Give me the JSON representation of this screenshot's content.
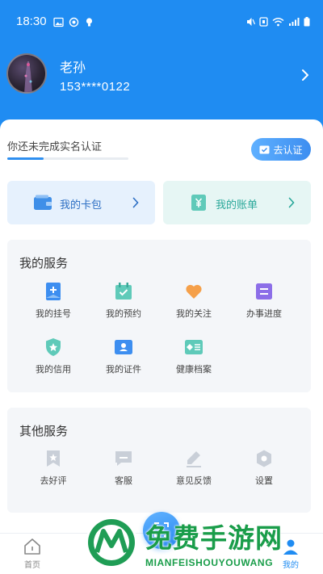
{
  "status_bar": {
    "time": "18:30"
  },
  "profile": {
    "name": "老孙",
    "phone": "153****0122"
  },
  "verify": {
    "text": "你还未完成实名认证",
    "button": "去认证",
    "progress": 0.3
  },
  "quick": {
    "wallet_label": "我的卡包",
    "bill_label": "我的账单"
  },
  "my_services": {
    "title": "我的服务",
    "items": [
      {
        "label": "我的挂号",
        "icon": "register-icon"
      },
      {
        "label": "我的预约",
        "icon": "appointment-icon"
      },
      {
        "label": "我的关注",
        "icon": "heart-icon"
      },
      {
        "label": "办事进度",
        "icon": "progress-icon"
      },
      {
        "label": "我的信用",
        "icon": "credit-shield-icon"
      },
      {
        "label": "我的证件",
        "icon": "id-card-icon"
      },
      {
        "label": "健康档案",
        "icon": "health-record-icon"
      }
    ]
  },
  "other_services": {
    "title": "其他服务",
    "items": [
      {
        "label": "去好评",
        "icon": "star-bookmark-icon"
      },
      {
        "label": "客服",
        "icon": "chat-icon"
      },
      {
        "label": "意见反馈",
        "icon": "pencil-icon"
      },
      {
        "label": "设置",
        "icon": "gear-icon"
      }
    ]
  },
  "tabbar": {
    "home": "首页",
    "me": "我的"
  },
  "watermark": {
    "title": "免费手游网",
    "subtitle": "MIANFEISHOUYOUWANG"
  },
  "colors": {
    "primary": "#1f8cf2",
    "green": "#1a9d4a"
  }
}
